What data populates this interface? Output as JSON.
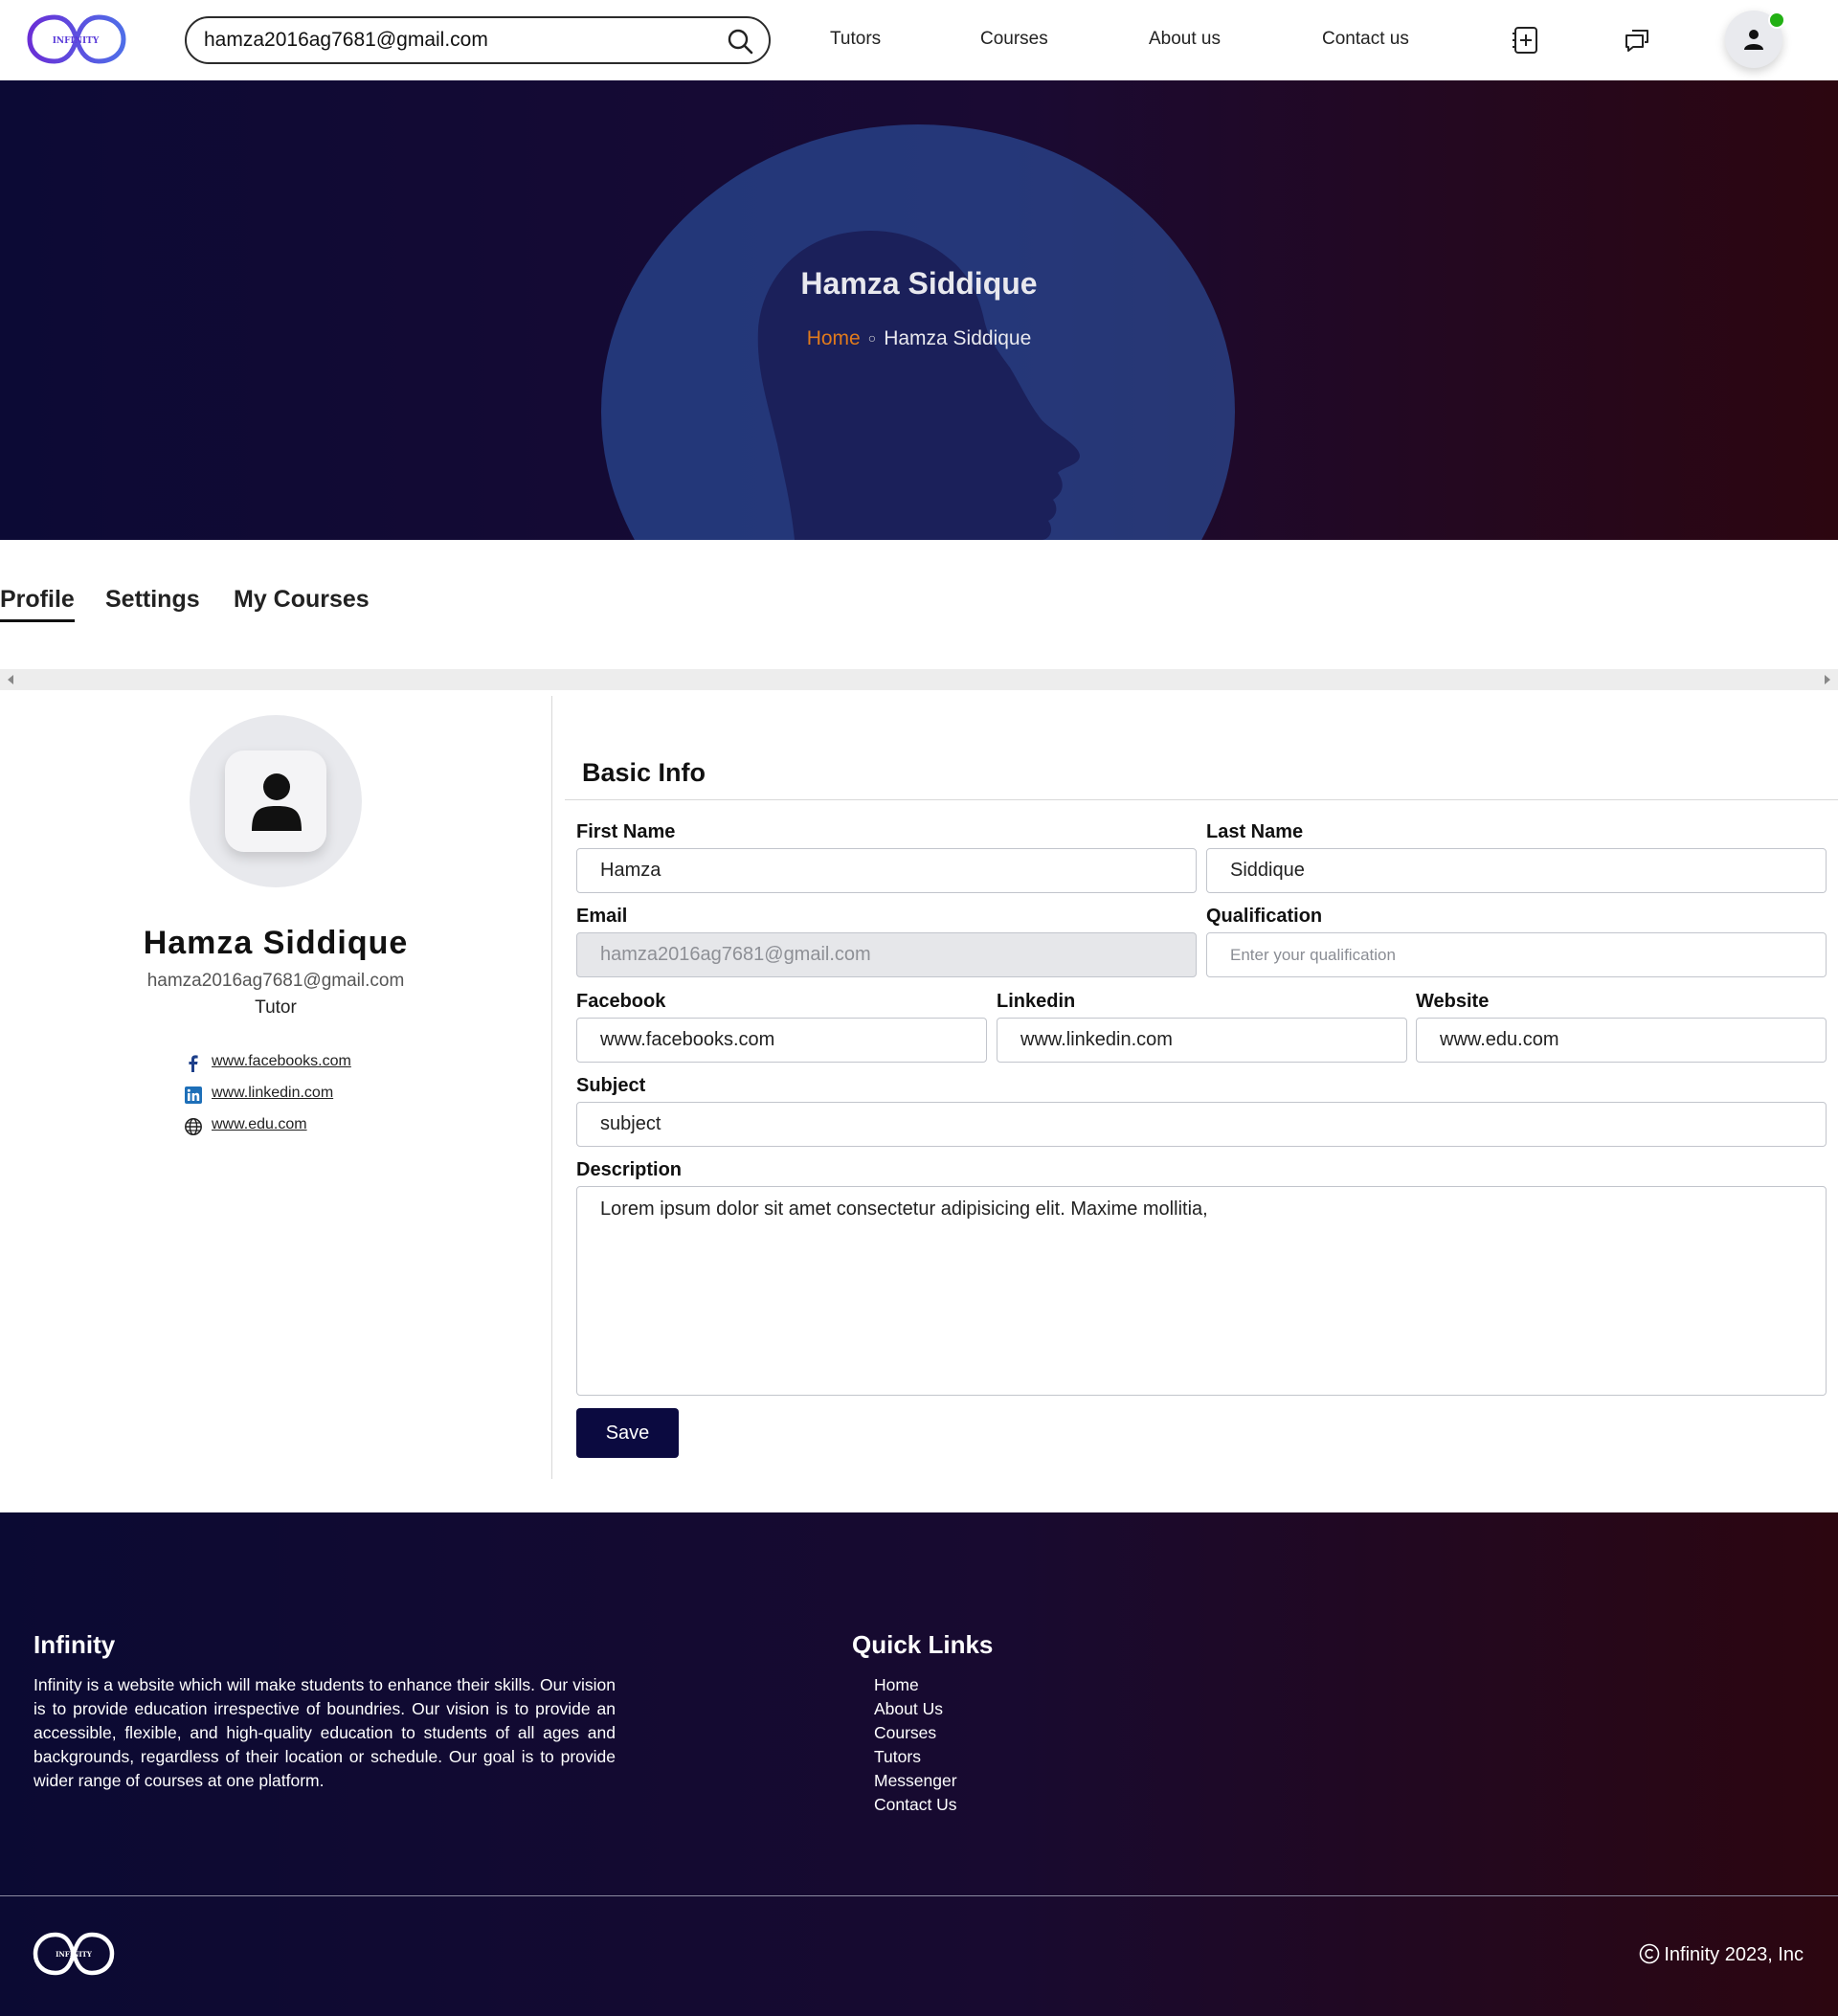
{
  "brand": {
    "logo_text": "INFINITY",
    "accent": "#6a3de8",
    "dark_navy": "#0b0a40",
    "orange": "#e07a1c",
    "online": "#22b014"
  },
  "navbar": {
    "search_value": "hamza2016ag7681@gmail.com",
    "links": [
      "Tutors",
      "Courses",
      "About us",
      "Contact us"
    ],
    "icons": [
      "search-icon",
      "add-contact-icon",
      "chat-icon",
      "user-icon"
    ]
  },
  "hero": {
    "title": "Hamza Siddique",
    "breadcrumb": {
      "home": "Home",
      "separator": "○",
      "current": "Hamza Siddique"
    }
  },
  "tabs": [
    {
      "label": "Profile",
      "active": true
    },
    {
      "label": "Settings",
      "active": false
    },
    {
      "label": "My Courses",
      "active": false
    }
  ],
  "profile": {
    "name": "Hamza Siddique",
    "email": "hamza2016ag7681@gmail.com",
    "role": "Tutor",
    "social": [
      {
        "icon": "facebook-icon",
        "text": "www.facebooks.com"
      },
      {
        "icon": "linkedin-icon",
        "text": "www.linkedin.com"
      },
      {
        "icon": "globe-icon",
        "text": "www.edu.com"
      }
    ]
  },
  "form": {
    "title": "Basic Info",
    "first_name": {
      "label": "First Name",
      "value": "Hamza"
    },
    "last_name": {
      "label": "Last Name",
      "value": "Siddique"
    },
    "email": {
      "label": "Email",
      "value": "hamza2016ag7681@gmail.com"
    },
    "qualification": {
      "label": "Qualification",
      "value": "",
      "placeholder": "Enter your qualification"
    },
    "facebook": {
      "label": "Facebook",
      "value": "www.facebooks.com"
    },
    "linkedin": {
      "label": "Linkedin",
      "value": "www.linkedin.com"
    },
    "website": {
      "label": "Website",
      "value": "www.edu.com"
    },
    "subject": {
      "label": "Subject",
      "value": "subject"
    },
    "description": {
      "label": "Description",
      "value": "Lorem ipsum dolor sit amet consectetur adipisicing elit. Maxime mollitia,"
    },
    "save_label": "Save"
  },
  "footer": {
    "title": "Infinity",
    "description": "Infinity is a website which will make students to enhance their skills. Our vision is to provide education irrespective of boundries. Our vision is to provide an accessible, flexible, and high-quality education to students of all ages and backgrounds, regardless of their location or schedule. Our goal is to provide wider range of courses at one platform.",
    "quick_links_title": "Quick Links",
    "quick_links": [
      "Home",
      "About Us",
      "Courses",
      "Tutors",
      "Messenger",
      "Contact Us"
    ],
    "logo_text": "INFINITY",
    "copyright": "Infinity 2023, Inc"
  }
}
